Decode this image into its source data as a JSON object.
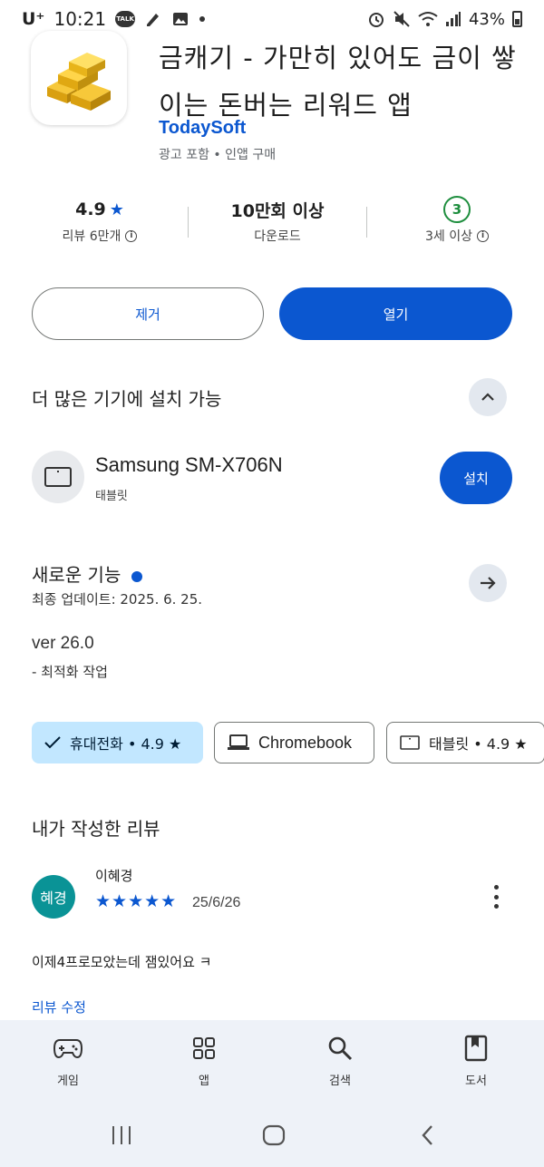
{
  "status_bar": {
    "carrier": "U⁺",
    "time": "10:21",
    "talk_icon": "TALK",
    "battery": "43%"
  },
  "app": {
    "title": "금캐기 - 가만히 있어도 금이 쌓이는 돈버는 리워드 앱",
    "developer": "TodaySoft",
    "ad_note": "광고 포함 • 인앱 구매"
  },
  "stats": {
    "rating_value": "4.9",
    "rating_label": "리뷰 6만개",
    "downloads_value": "10만회 이상",
    "downloads_label": "다운로드",
    "age_value": "3",
    "age_label": "3세 이상"
  },
  "actions": {
    "remove_label": "제거",
    "open_label": "열기"
  },
  "more_devices": {
    "title": "더 많은 기기에 설치 가능",
    "device_name": "Samsung SM-X706N",
    "device_type": "태블릿",
    "install_label": "설치"
  },
  "whats_new": {
    "title": "새로운 기능",
    "updated": "최종 업데이트: 2025. 6. 25.",
    "version": "ver 26.0",
    "note": "- 최적화 작업"
  },
  "chips": [
    {
      "label": "휴대전화 • 4.9 ★"
    },
    {
      "label": "Chromebook"
    },
    {
      "label": "태블릿 • 4.9 ★"
    }
  ],
  "my_review": {
    "title": "내가 작성한 리뷰",
    "avatar_text": "혜경",
    "reviewer": "이혜경",
    "stars": "★★★★★",
    "rating": 5,
    "date": "25/6/26",
    "text": "이제4프로모았는데 잼있어요 ㅋ",
    "edit_label": "리뷰 수정"
  },
  "bottom_nav": [
    {
      "label": "게임",
      "icon": "gamepad-icon"
    },
    {
      "label": "앱",
      "icon": "apps-grid-icon"
    },
    {
      "label": "검색",
      "icon": "search-icon"
    },
    {
      "label": "도서",
      "icon": "book-icon"
    }
  ],
  "colors": {
    "primary": "#0b57d0",
    "chip_selected": "#c2e7ff",
    "age_green": "#1e8e3e",
    "avatar": "#0a9396",
    "nav_bg": "#eef2f8"
  }
}
